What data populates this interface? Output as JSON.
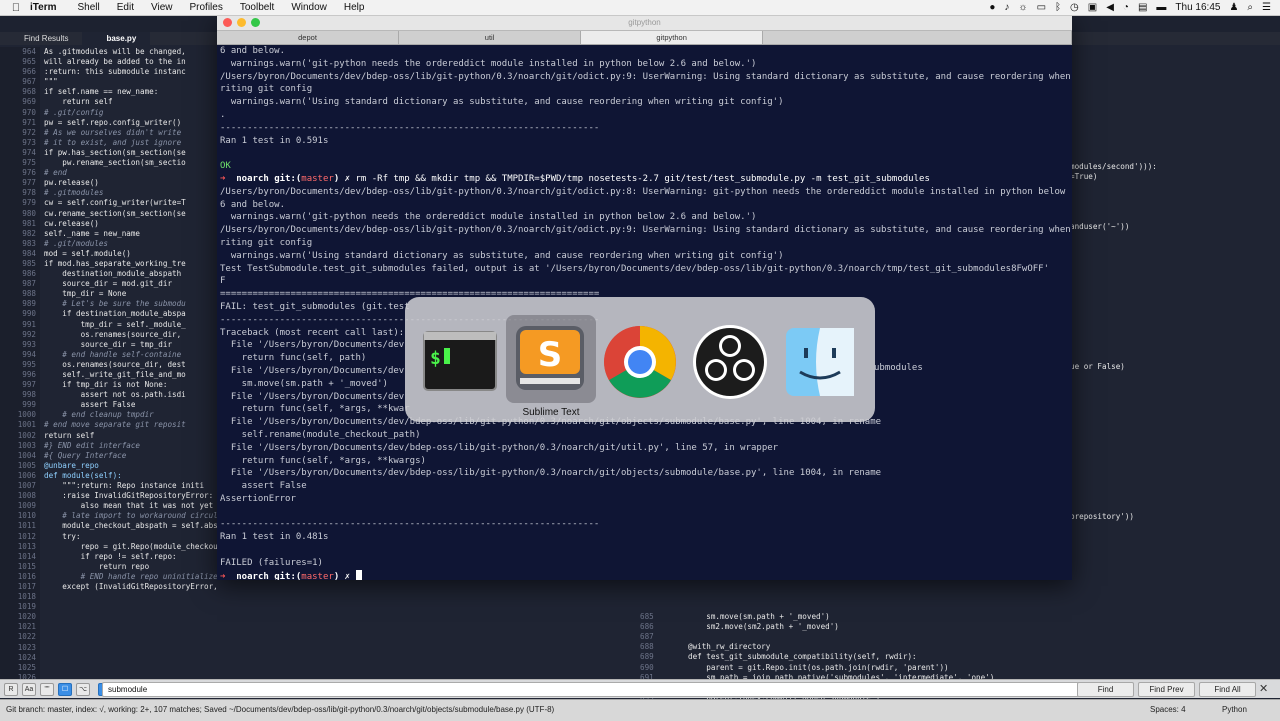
{
  "menubar": {
    "app": "iTerm",
    "items": [
      "Shell",
      "Edit",
      "View",
      "Profiles",
      "Toolbelt",
      "Window",
      "Help"
    ],
    "clock": "Thu 16:45"
  },
  "sublime": {
    "tabs": [
      "Find Results",
      "base.py"
    ],
    "gutter": [
      "964",
      "965",
      "966",
      "967",
      "968",
      "969",
      "970",
      "971",
      "972",
      "973",
      "974",
      "975",
      "976",
      "977",
      "978",
      "979",
      "980",
      "981",
      "982",
      "983",
      "984",
      "985",
      "986",
      "987",
      "988",
      "989",
      "990",
      "991",
      "992",
      "993",
      "994",
      "995",
      "996",
      "997",
      "998",
      "999",
      "1000",
      "1001",
      "1002",
      "1003",
      "1004",
      "1005",
      "1006",
      "1007",
      "1008",
      "1009",
      "1010",
      "1011",
      "1012",
      "1013",
      "1014",
      "1015",
      "1016",
      "1017",
      "1018",
      "1019",
      "1020",
      "1021",
      "1022",
      "1023",
      "1024",
      "1025",
      "1026"
    ],
    "code": [
      "As .gitmodules will be changed,",
      "will already be added to the in",
      "",
      ":return: this submodule instanc",
      "\"\"\"",
      "if self.name == new_name:",
      "    return self",
      "",
      "# .git/config",
      "pw = self.repo.config_writer()",
      "# As we ourselves didn't write",
      "# it to exist, and just ignore",
      "if pw.has_section(sm_section(se",
      "    pw.rename_section(sm_sectio",
      "# end",
      "pw.release()",
      "",
      "# .gitmodules",
      "cw = self.config_writer(write=T",
      "cw.rename_section(sm_section(se",
      "cw.release()",
      "",
      "self._name = new_name",
      "",
      "# .git/modules",
      "mod = self.module()",
      "if mod.has_separate_working_tre",
      "    destination_module_abspath",
      "    source_dir = mod.git_dir",
      "    tmp_dir = None",
      "    # Let's be sure the submodu",
      "    if destination_module_abspa",
      "        tmp_dir = self._module_",
      "        os.renames(source_dir,",
      "        source_dir = tmp_dir",
      "    # end handle self-containe",
      "    os.renames(source_dir, dest",
      "    self._write_git_file_and_mo",
      "    if tmp_dir is not None:",
      "        assert not os.path.isdi",
      "        assert False",
      "    # end cleanup tmpdir",
      "# end move separate git reposit",
      "",
      "return self",
      "",
      "#} END edit interface",
      "",
      "#{ Query Interface",
      "",
      "@unbare_repo",
      "def module(self):",
      "    \"\"\":return: Repo instance initi",
      "    :raise InvalidGitRepositoryError:",
      "        also mean that it was not yet initialized\"\"\"",
      "    # late import to workaround circular dependencies",
      "    module_checkout_abspath = self.abspath",
      "    try:",
      "        repo = git.Repo(module_checkout_abspath)",
      "        if repo != self.repo:",
      "            return repo",
      "        # END handle repo uninitialized",
      "    except (InvalidGitRepositoryError, NoSuchPathError):"
    ],
    "right_fragments": [
      "modules/second'))):",
      "=True)",
      "anduser('~'))",
      "ue or False)",
      "brepository'))"
    ],
    "pane2_gutter": [
      "685",
      "686",
      "687",
      "688",
      "689",
      "690",
      "691",
      "692",
      "693"
    ],
    "pane2_code": [
      "    sm.move(sm.path + '_moved')",
      "    sm2.move(sm2.path + '_moved')",
      "",
      "@with_rw_directory",
      "def test_git_submodule_compatibility(self, rwdir):",
      "    parent = git.Repo.init(os.path.join(rwdir, 'parent'))",
      "    sm_path = join_path_native('submodules', 'intermediate', 'one')",
      "    sm = parent.create_submodule('mymodules/myname', sm_path, url=self._small_repo_url())",
      "    parent.index.commit(\"added submodule\")"
    ],
    "find": {
      "query": "submodule",
      "buttons": [
        "Find",
        "Find Prev",
        "Find All"
      ],
      "options": [
        "R",
        "Aa",
        "\"\"",
        "☐",
        "⌥"
      ]
    },
    "status": {
      "left": "Git branch: master, index: √, working: 2+, 107 matches; Saved ~/Documents/dev/bdep-oss/lib/git-python/0.3/noarch/git/objects/submodule/base.py (UTF-8)",
      "spaces": "Spaces: 4",
      "syntax": "Python"
    }
  },
  "iterm": {
    "title": "gitpython",
    "tabs": [
      "depot",
      "util",
      "gitpython"
    ],
    "lines": [
      "6 and below.",
      "  warnings.warn('git-python needs the ordereddict module installed in python below 2.6 and below.')",
      "/Users/byron/Documents/dev/bdep-oss/lib/git-python/0.3/noarch/git/odict.py:9: UserWarning: Using standard dictionary as substitute, and cause reordering when w",
      "riting git config",
      "  warnings.warn('Using standard dictionary as substitute, and cause reordering when writing git config')",
      ".",
      "----------------------------------------------------------------------",
      "Ran 1 test in 0.591s",
      "",
      "OK",
      "@@PROMPT1@@",
      "/Users/byron/Documents/dev/bdep-oss/lib/git-python/0.3/noarch/git/odict.py:8: UserWarning: git-python needs the ordereddict module installed in python below 2.",
      "6 and below.",
      "  warnings.warn('git-python needs the ordereddict module installed in python below 2.6 and below.')",
      "/Users/byron/Documents/dev/bdep-oss/lib/git-python/0.3/noarch/git/odict.py:9: UserWarning: Using standard dictionary as substitute, and cause reordering when w",
      "riting git config",
      "  warnings.warn('Using standard dictionary as substitute, and cause reordering when writing git config')",
      "Test TestSubmodule.test_git_submodules failed, output is at '/Users/byron/Documents/dev/bdep-oss/lib/git-python/0.3/noarch/tmp/test_git_submodules8FwOFF'",
      "F",
      "======================================================================",
      "FAIL: test_git_submodules (git.test",
      "----------------------------------------------------------------------",
      "Traceback (most recent call last):",
      "  File '/Users/byron/Documents/dev",
      "    return func(self, path)",
      "  File '/Users/byron/Documents/dev",
      "    sm.move(sm.path + '_moved')",
      "  File '/Users/byron/Documents/dev",
      "    return func(self, *args, **kwar",
      "  File '/Users/byron/Documents/dev/bdep-oss/lib/git-python/0.3/noarch/git/objects/submodule/base.py', line 1004, in rename",
      "    self.rename(module_checkout_path)",
      "  File '/Users/byron/Documents/dev/bdep-oss/lib/git-python/0.3/noarch/git/util.py', line 57, in wrapper",
      "    return func(self, *args, **kwargs)",
      "  File '/Users/byron/Documents/dev/bdep-oss/lib/git-python/0.3/noarch/git/objects/submodule/base.py', line 1004, in rename",
      "    assert False",
      "AssertionError",
      "",
      "----------------------------------------------------------------------",
      "Ran 1 test in 0.481s",
      "",
      "FAILED (failures=1)",
      "@@PROMPT2@@"
    ],
    "prompt1_cmd": "rm -Rf tmp && mkdir tmp && TMPDIR=$PWD/tmp nosetests-2.7 git/test/test_submodule.py -m test_git_submodules",
    "prompt_host": "noarch git:(",
    "prompt_branch": "master",
    "prompt_end": ") ✗",
    "right_side": "ubmodules"
  },
  "switcher": {
    "selected_label": "Sublime Text",
    "apps": [
      "iterm-icon",
      "sublime-text-icon",
      "chrome-icon",
      "obs-icon",
      "finder-icon"
    ]
  }
}
